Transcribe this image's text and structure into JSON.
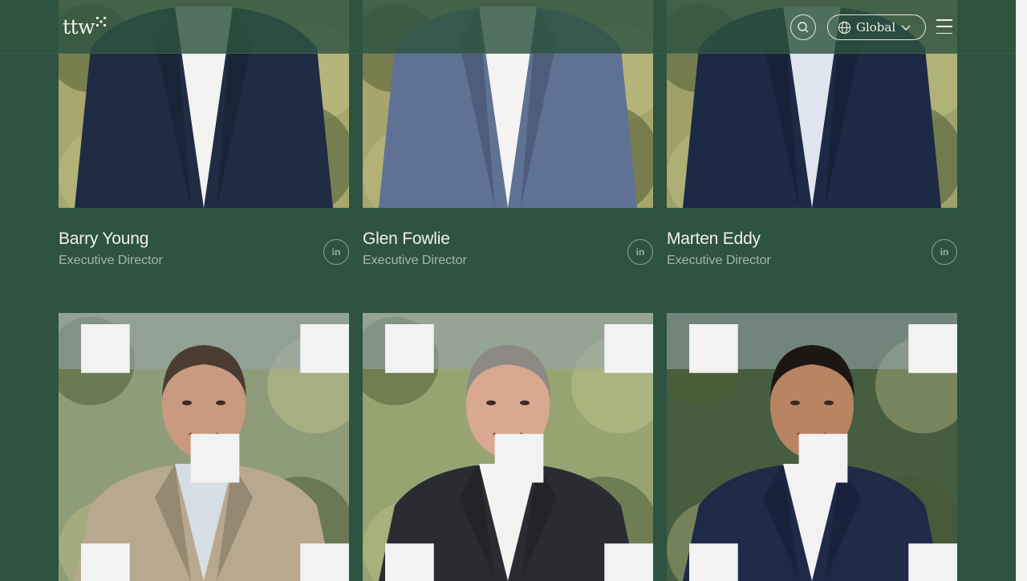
{
  "header": {
    "logo_text": "ttw",
    "region_label": "Global",
    "icons": {
      "search": "search-icon",
      "globe": "globe-icon",
      "chevron": "chevron-down-icon",
      "menu": "menu-icon"
    }
  },
  "colors": {
    "background": "#2e5340",
    "header_text": "#f1efe6",
    "role_text": "#a8b5ab"
  },
  "people_row1": [
    {
      "name": "Barry Young",
      "role": "Executive Director",
      "suit": "#1f2c44",
      "shirt": "#f2f2f0",
      "bg": "#a7a66c"
    },
    {
      "name": "Glen Fowlie",
      "role": "Executive Director",
      "suit": "#5f7296",
      "shirt": "#f4f3f1",
      "bg": "#a8a56a"
    },
    {
      "name": "Marten Eddy",
      "role": "Executive Director",
      "suit": "#1d2a45",
      "shirt": "#dfe5ee",
      "bg": "#9fa169"
    }
  ],
  "people_row2": [
    {
      "suit": "#b7a88e",
      "shirt": "#d7dde4",
      "skin": "#c99a80",
      "hair": "#4a3c33",
      "bg": "#8f9c79"
    },
    {
      "suit": "#2a2c31",
      "shirt": "#f3f3f1",
      "skin": "#d9a890",
      "hair": "#8d8a86",
      "bg": "#97a472"
    },
    {
      "suit": "#1e2a48",
      "shirt": "#f2f2f2",
      "skin": "#b98463",
      "hair": "#1c1614",
      "bg": "#465d3f"
    }
  ]
}
